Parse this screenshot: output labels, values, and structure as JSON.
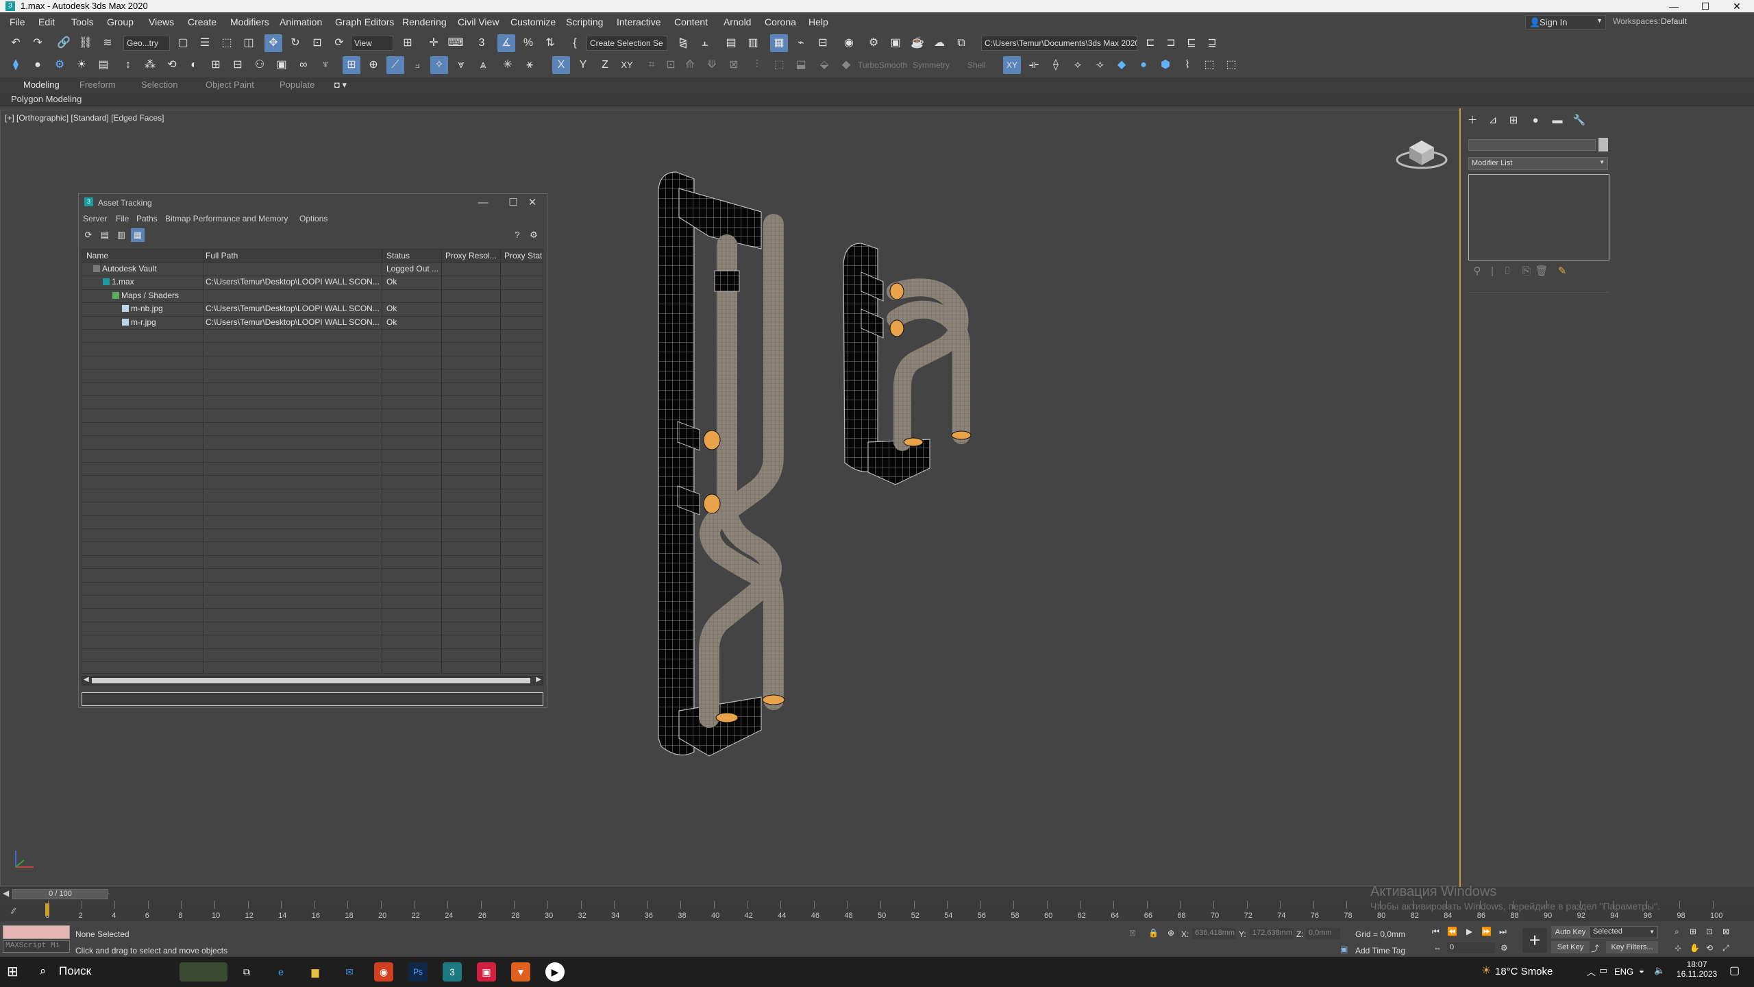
{
  "window": {
    "title": "1.max - Autodesk 3ds Max 2020",
    "minimize": "—",
    "maximize": "☐",
    "close": "✕"
  },
  "menu": [
    "File",
    "Edit",
    "Tools",
    "Group",
    "Views",
    "Create",
    "Modifiers",
    "Animation",
    "Graph Editors",
    "Rendering",
    "Civil View",
    "Customize",
    "Scripting",
    "Interactive",
    "Content",
    "Arnold",
    "Corona",
    "Help"
  ],
  "account": {
    "sign_in": "Sign In",
    "workspaces_label": "Workspaces:",
    "workspace": "Default"
  },
  "toolbar": {
    "selection_filter": "Geo...try",
    "view_dropdown": "View",
    "selection_set": "Create Selection Se",
    "project_path": "C:\\Users\\Temur\\Documents\\3ds Max 2020",
    "turbosmooth": "TurboSmooth",
    "symmetry": "Symmetry",
    "shell": "Shell",
    "x_axis": "X",
    "y_axis": "Y",
    "z_axis": "Z",
    "xy_axis": "XY"
  },
  "ribbon": {
    "tabs": [
      "Modeling",
      "Freeform",
      "Selection",
      "Object Paint",
      "Populate"
    ],
    "panel_label": "Polygon Modeling"
  },
  "viewport": {
    "label": "[+] [Orthographic] [Standard] [Edged Faces]"
  },
  "command_panel": {
    "modifier_list": "Modifier List"
  },
  "asset_tracking": {
    "title": "Asset Tracking",
    "menu": [
      "Server",
      "File",
      "Paths",
      "Bitmap Performance and Memory",
      "Options"
    ],
    "columns": [
      "Name",
      "Full Path",
      "Status",
      "Proxy Resol...",
      "Proxy Statu"
    ],
    "rows": [
      {
        "name": "Autodesk Vault",
        "path": "",
        "status": "Logged Out ...",
        "indent": 0,
        "icon": "vault"
      },
      {
        "name": "1.max",
        "path": "C:\\Users\\Temur\\Desktop\\LOOPI WALL SCON...",
        "status": "Ok",
        "indent": 1,
        "icon": "max"
      },
      {
        "name": "Maps / Shaders",
        "path": "",
        "status": "",
        "indent": 2,
        "icon": "maps"
      },
      {
        "name": "m-nb.jpg",
        "path": "C:\\Users\\Temur\\Desktop\\LOOPI WALL SCON...",
        "status": "Ok",
        "indent": 3,
        "icon": "image"
      },
      {
        "name": "m-r.jpg",
        "path": "C:\\Users\\Temur\\Desktop\\LOOPI WALL SCON...",
        "status": "Ok",
        "indent": 3,
        "icon": "image"
      }
    ]
  },
  "timeline": {
    "frame": "0 / 100",
    "ticks": [
      "0",
      "2",
      "4",
      "6",
      "8",
      "10",
      "12",
      "14",
      "16",
      "18",
      "20",
      "22",
      "24",
      "26",
      "28",
      "30",
      "32",
      "34",
      "36",
      "38",
      "40",
      "42",
      "44",
      "46",
      "48",
      "50",
      "52",
      "54",
      "56",
      "58",
      "60",
      "62",
      "64",
      "66",
      "68",
      "70",
      "72",
      "74",
      "76",
      "78",
      "80",
      "82",
      "84",
      "86",
      "88",
      "90",
      "92",
      "94",
      "96",
      "98",
      "100"
    ]
  },
  "status": {
    "maxscript": "MAXScript Mi",
    "selection": "None Selected",
    "prompt": "Click and drag to select and move objects",
    "x_label": "X:",
    "x_value": "636,418mm",
    "y_label": "Y:",
    "y_value": "172,638mm",
    "z_label": "Z:",
    "z_value": "0,0mm",
    "grid": "Grid = 0,0mm",
    "add_time_tag": "Add Time Tag",
    "auto_key": "Auto Key",
    "set_key": "Set Key",
    "selected": "Selected",
    "key_filters": "Key Filters...",
    "frame_field": "0"
  },
  "activation": {
    "line1": "Активация Windows",
    "line2": "Чтобы активировать Windows, перейдите в раздел \"Параметры\"."
  },
  "taskbar": {
    "search": "Поиск",
    "weather": "18°C  Smoke",
    "lang": "ENG",
    "time": "18:07",
    "date": "16.11.2023"
  }
}
